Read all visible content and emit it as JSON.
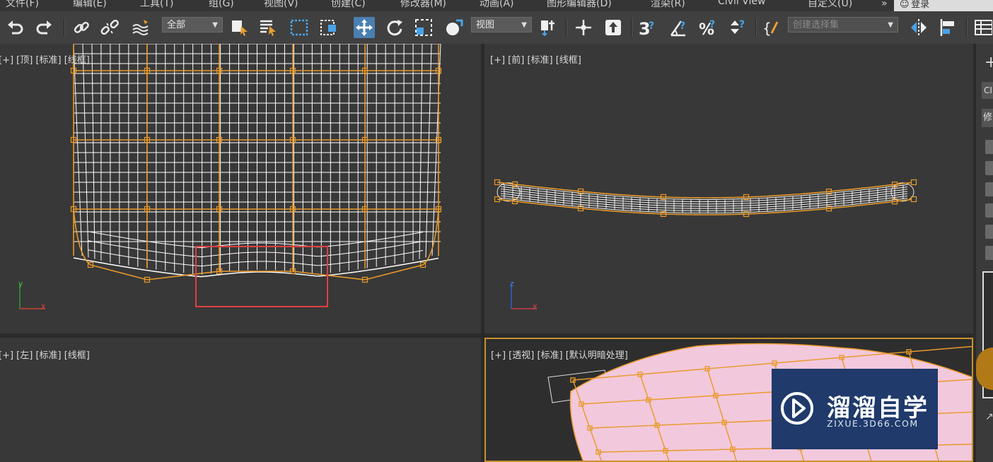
{
  "menu": {
    "items": [
      "文件(F)",
      "编辑(E)",
      "工具(T)",
      "组(G)",
      "视图(V)",
      "创建(C)",
      "修改器(M)",
      "动画(A)",
      "图形编辑器(D)",
      "渲染(R)",
      "Civil View",
      "自定义(U)"
    ],
    "overflow": "»",
    "login": "登录"
  },
  "toolbar": {
    "filter_value": "全部",
    "coord_value": "视图",
    "selection_set_placeholder": "创建选择集",
    "icons": [
      "undo-icon",
      "redo-icon",
      "link-icon",
      "unlink-icon",
      "bind-space-warp-icon",
      "select-object-icon",
      "select-by-name-icon",
      "rect-selection-icon",
      "window-crossing-icon",
      "select-move-icon",
      "select-rotate-icon",
      "select-scale-icon",
      "select-place-icon",
      "pivot-icon",
      "snap-icon",
      "select-manipulate-icon",
      "snap-3d-icon",
      "angle-snap-icon",
      "percent-snap-icon",
      "spinner-snap-icon",
      "edit-named-selection-icon",
      "mirror-icon",
      "align-icon",
      "layer-explorer-icon"
    ],
    "active_tool": "select-move-icon"
  },
  "viewports": {
    "top": {
      "label": "[+] [顶] [标准] [线框]"
    },
    "front": {
      "label": "[+] [前] [标准] [线框]"
    },
    "left": {
      "label": "[+] [左] [标准] [线框]"
    },
    "perspective": {
      "label": "[+] [透视] [标准] [默认明暗处理]"
    }
  },
  "axis": {
    "x": "x",
    "y": "y",
    "z": "z"
  },
  "right_panel": {
    "labels": [
      "CI",
      "修"
    ]
  },
  "colors": {
    "wire": "#ffffff",
    "cage": "#e89a2a",
    "selection_box": "#e04040",
    "mesh_fill": "#f2c8dc",
    "active_border": "#c8922c",
    "accent": "#4a7fb0"
  },
  "watermark": {
    "title": "溜溜自学",
    "subtitle": "ZIXUE.3D66.COM"
  }
}
